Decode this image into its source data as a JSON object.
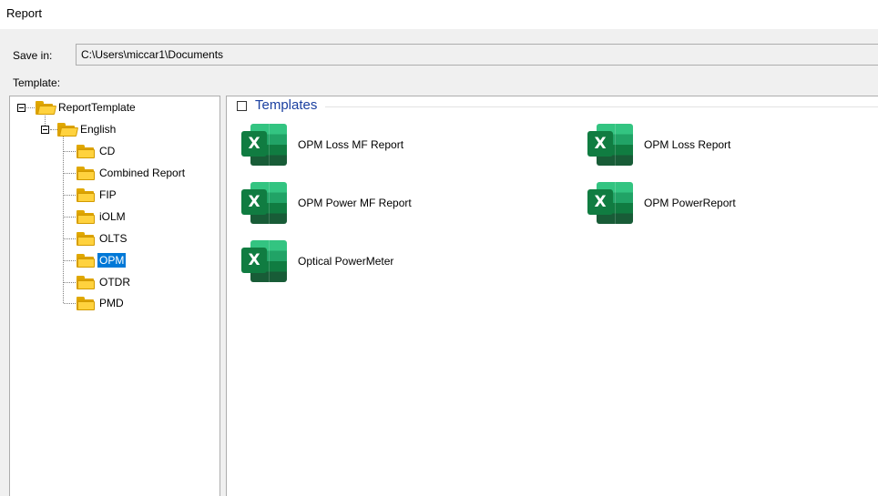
{
  "window": {
    "title": "Report"
  },
  "save": {
    "label": "Save in:",
    "path": "C:\\Users\\miccar1\\Documents"
  },
  "template": {
    "label": "Template:"
  },
  "tree": {
    "root": "ReportTemplate",
    "child": "English",
    "folders": [
      "CD",
      "Combined Report",
      "FIP",
      "iOLM",
      "OLTS",
      "OPM",
      "OTDR",
      "PMD"
    ],
    "selected": "OPM"
  },
  "templates": {
    "group_title": "Templates",
    "items": [
      {
        "label": "OPM Loss MF Report",
        "icon": "excel-file-icon"
      },
      {
        "label": "OPM Loss Report",
        "icon": "excel-file-icon"
      },
      {
        "label": "OPM Power MF Report",
        "icon": "excel-file-icon"
      },
      {
        "label": "OPM PowerReport",
        "icon": "excel-file-icon"
      },
      {
        "label": "Optical PowerMeter",
        "icon": "excel-file-icon"
      }
    ]
  },
  "colors": {
    "selection": "#0078d7",
    "group_title": "#1a3fa0",
    "excel_green": "#107c41",
    "folder_yellow": "#ffd23e"
  }
}
